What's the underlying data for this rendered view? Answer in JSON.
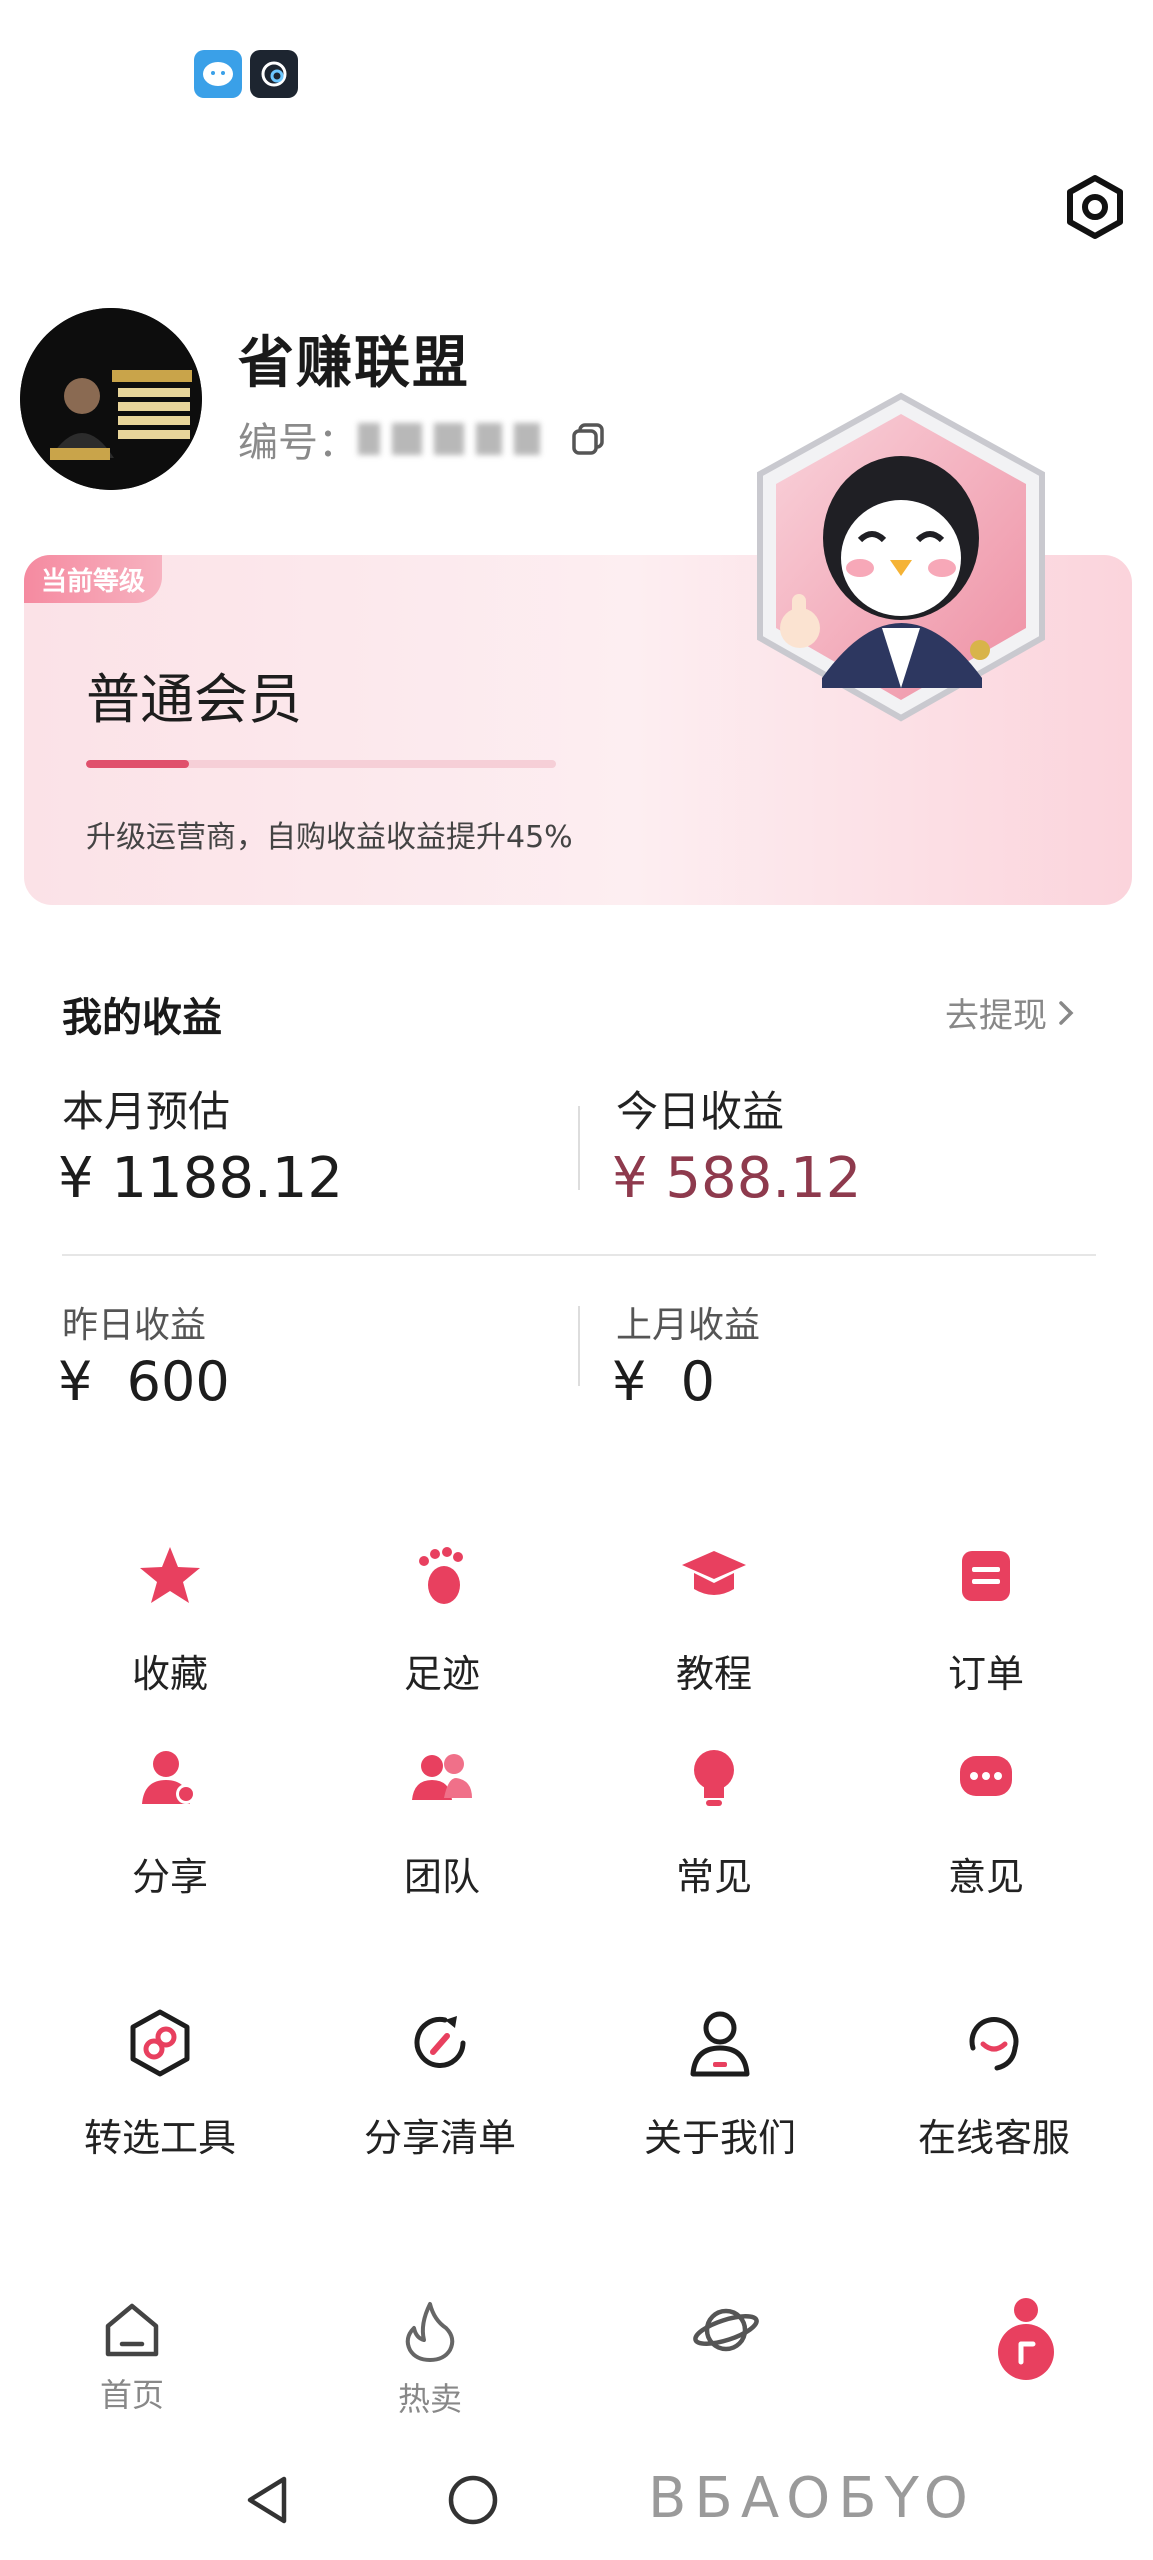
{
  "profile": {
    "username": "省赚联盟",
    "id_label": "编号："
  },
  "level": {
    "tag": "当前等级",
    "name": "普通会员",
    "progress_fraction": 0.22,
    "hint": "升级运营商，自购收益收益提升45%"
  },
  "earnings": {
    "title": "我的收益",
    "withdraw_label": "去提现",
    "month_estimate_label": "本月预估",
    "month_estimate_value": "¥ 1188.12",
    "today_label": "今日收益",
    "today_value": "¥ 588.12",
    "yesterday_label": "昨日收益",
    "yesterday_value": "¥  600",
    "last_month_label": "上月收益",
    "last_month_value": "¥  0"
  },
  "grid": [
    {
      "label": "收藏",
      "icon": "star-icon"
    },
    {
      "label": "足迹",
      "icon": "footprint-icon"
    },
    {
      "label": "教程",
      "icon": "graduation-cap-icon"
    },
    {
      "label": "订单",
      "icon": "order-icon"
    },
    {
      "label": "分享",
      "icon": "share-user-icon"
    },
    {
      "label": "团队",
      "icon": "team-icon"
    },
    {
      "label": "常见",
      "icon": "lightbulb-icon"
    },
    {
      "label": "意见",
      "icon": "chat-bubble-icon"
    }
  ],
  "tools": [
    {
      "label": "转选工具",
      "icon": "link-hexagon-icon"
    },
    {
      "label": "分享清单",
      "icon": "share-list-icon"
    },
    {
      "label": "关于我们",
      "icon": "person-outline-icon"
    },
    {
      "label": "在线客服",
      "icon": "customer-service-icon"
    }
  ],
  "nav": [
    {
      "label": "首页",
      "icon": "home-icon"
    },
    {
      "label": "热卖",
      "icon": "flame-icon"
    },
    {
      "label": "",
      "icon": "planet-icon"
    },
    {
      "label": "",
      "icon": "profile-icon"
    }
  ],
  "watermark": "BБAOБYO",
  "colors": {
    "accent": "#e8405f",
    "today_value": "#8e3a4d"
  }
}
